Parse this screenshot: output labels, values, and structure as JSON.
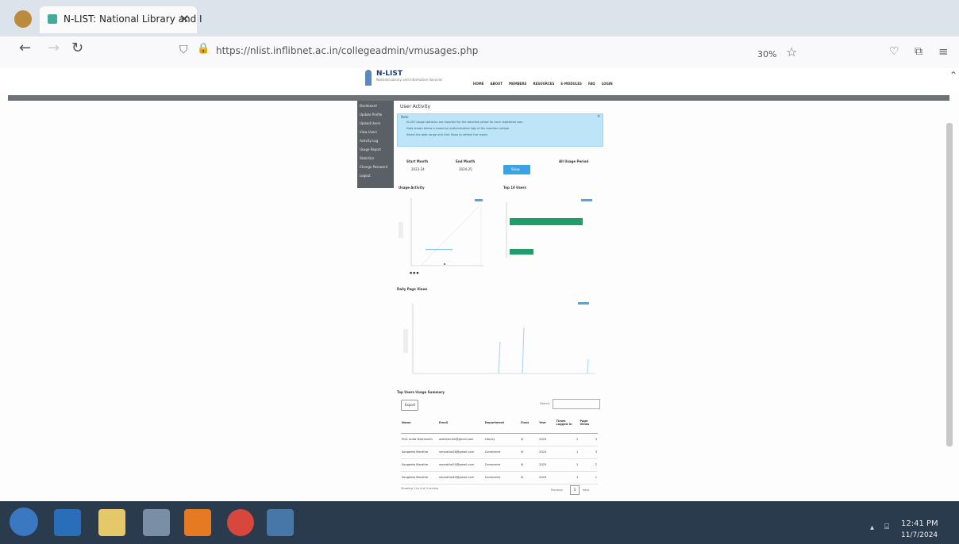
{
  "browser": {
    "tab_title": "N-LIST: National Library and I",
    "url": "https://nlist.inflibnet.ac.in/collegeadmin/vmusages.php",
    "zoom": "30%"
  },
  "site": {
    "logo": "N-LIST",
    "tagline": "National Library and Information Services",
    "menu": [
      "HOME",
      "ABOUT",
      "MEMBERS",
      "RESOURCES",
      "E-MODULES",
      "FAQ",
      "LOGIN"
    ]
  },
  "sidebar": {
    "items": [
      "Dashboard",
      "Update Profile",
      "Upload Users",
      "View Users",
      "Activity Log",
      "Usage Report",
      "Statistics",
      "Change Password",
      "Logout"
    ]
  },
  "page": {
    "title": "User Activity",
    "info": {
      "heading": "Note",
      "lines": [
        "N-LIST usage statistics are reported for the selected period for each registered user.",
        "Data shown below is based on authentication logs of the member college.",
        "Select the date range and click Show to refresh the report."
      ]
    },
    "start_label": "Start Month",
    "start_value": "2023-24",
    "end_label": "End Month",
    "end_value": "2024-25",
    "show_button": "Show",
    "right_label": "All Usage Period",
    "chart1_title": "Usage Activity",
    "chart2_title": "Top 10 Users",
    "chart3_title": "Daily Page Views",
    "table_title": "Top Users Usage Summary",
    "search_label": "Search:",
    "export_btn": "Export",
    "table": {
      "headers": [
        "Name",
        "Email",
        "Department",
        "Class",
        "Year",
        "Times Logged In",
        "Page Views"
      ],
      "rows": [
        [
          "Prof. Anita Deshmukh",
          "adeshmukh@gmail.com",
          "Library",
          "III",
          "2023",
          "2",
          "3"
        ],
        [
          "Sangeeta Marathe",
          "smarathe28@gmail.com",
          "Commerce",
          "III",
          "2023",
          "1",
          "3"
        ],
        [
          "Sangeeta Marathe",
          "smarathe29@gmail.com",
          "Commerce",
          "III",
          "2023",
          "1",
          "2"
        ],
        [
          "Sangeeta Marathe",
          "smarathe30@gmail.com",
          "Commerce",
          "III",
          "2023",
          "1",
          "1"
        ]
      ]
    },
    "footer": "Showing 1 to 4 of 4 entries",
    "prev": "Previous",
    "page_num": "1",
    "next": "Next"
  },
  "taskbar": {
    "time": "12:41 PM",
    "date": "11/7/2024"
  }
}
